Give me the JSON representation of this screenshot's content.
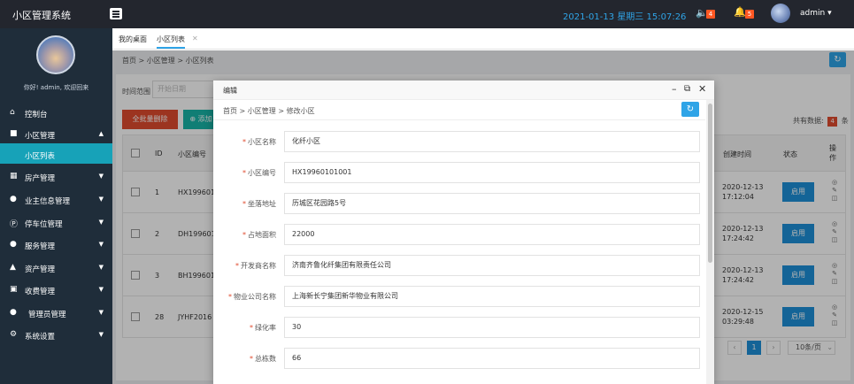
{
  "app": {
    "title": "小区管理系统"
  },
  "header": {
    "date": "2021-01-13",
    "weekday": "星期三",
    "time": "15:07:26",
    "notice_count": "4",
    "message_count": "5",
    "username": "admin"
  },
  "sidebar": {
    "greeting": "你好! admin, 欢迎回来",
    "items": [
      {
        "label": "控制台",
        "icon": "home-icon"
      },
      {
        "label": "小区管理",
        "icon": "building-icon"
      },
      {
        "label": "小区列表",
        "icon": ""
      },
      {
        "label": "房产管理",
        "icon": "apartment-icon"
      },
      {
        "label": "业主信息管理",
        "icon": "user-icon"
      },
      {
        "label": "停车位管理",
        "icon": "parking-icon"
      },
      {
        "label": "服务管理",
        "icon": "service-icon"
      },
      {
        "label": "资产管理",
        "icon": "asset-icon"
      },
      {
        "label": "收费管理",
        "icon": "fee-icon"
      },
      {
        "label": "管理员管理",
        "icon": "admin-icon"
      },
      {
        "label": "系统设置",
        "icon": "gear-icon"
      }
    ]
  },
  "tabs": [
    {
      "label": "我的桌面"
    },
    {
      "label": "小区列表"
    }
  ],
  "breadcrumb": {
    "text": "首页 > 小区管理 > 小区列表"
  },
  "toolbar": {
    "time_label": "时间范围",
    "time_placeholder": "开始日期",
    "batch_delete": "全批量删除",
    "add": "添加",
    "total_label": "共有数据:",
    "total_count": "4",
    "total_unit": "条"
  },
  "table": {
    "headers": {
      "id": "ID",
      "code": "小区编号",
      "created": "创建时间",
      "status": "状态",
      "ops": "操作"
    },
    "rows": [
      {
        "id": "1",
        "code": "HX199601",
        "date": "2020-12-13",
        "time": "17:12:04",
        "status": "启用"
      },
      {
        "id": "2",
        "code": "DH199601",
        "date": "2020-12-13",
        "time": "17:24:42",
        "status": "启用"
      },
      {
        "id": "3",
        "code": "BH199601",
        "date": "2020-12-13",
        "time": "17:24:42",
        "status": "启用"
      },
      {
        "id": "28",
        "code": "JYHF2016",
        "date": "2020-12-15",
        "time": "03:29:48",
        "status": "启用"
      }
    ]
  },
  "pager": {
    "current": "1",
    "page_size": "10条/页"
  },
  "modal": {
    "title": "编辑",
    "breadcrumb": "首页 > 小区管理 > 修改小区",
    "fields": [
      {
        "label": "小区名称",
        "value": "化纤小区"
      },
      {
        "label": "小区编号",
        "value": "HX19960101001"
      },
      {
        "label": "坐落地址",
        "value": "历城区花园路5号"
      },
      {
        "label": "占地面积",
        "value": "22000"
      },
      {
        "label": "开发商名称",
        "value": "济南齐鲁化纤集团有限责任公司"
      },
      {
        "label": "物业公司名称",
        "value": "上海新长宁集团新华物业有限公司"
      },
      {
        "label": "绿化率",
        "value": "30"
      },
      {
        "label": "总栋数",
        "value": "66"
      }
    ]
  }
}
